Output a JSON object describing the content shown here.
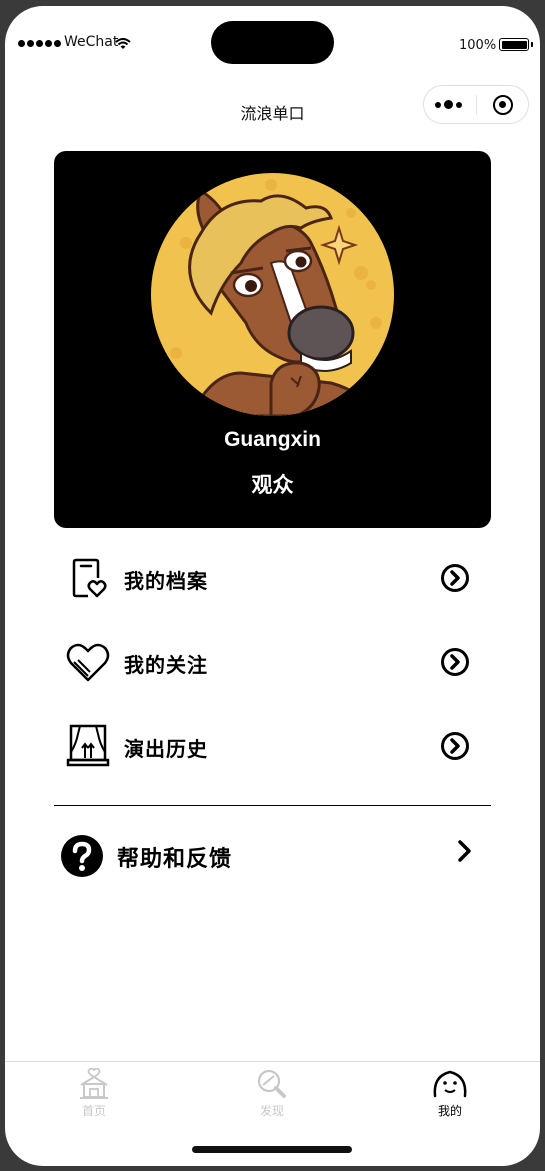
{
  "status_bar": {
    "carrier": "WeChat",
    "battery": "100%"
  },
  "nav": {
    "title": "流浪单口"
  },
  "profile": {
    "username": "Guangxin",
    "role": "观众"
  },
  "menu": [
    {
      "label": "我的档案",
      "icon": "profile-file-heart-icon"
    },
    {
      "label": "我的关注",
      "icon": "heart-outline-icon"
    },
    {
      "label": "演出历史",
      "icon": "stage-curtain-icon"
    }
  ],
  "help": {
    "label": "帮助和反馈",
    "icon": "question-circle-icon"
  },
  "tabbar": [
    {
      "label": "首页",
      "icon": "home-icon",
      "active": false
    },
    {
      "label": "发现",
      "icon": "discover-icon",
      "active": false
    },
    {
      "label": "我的",
      "icon": "smile-face-icon",
      "active": true
    }
  ],
  "colors": {
    "card_bg": "#000000",
    "avatar_bg": "#f2c24e",
    "inactive_tab": "#c8c8c8",
    "active_tab": "#000000"
  }
}
